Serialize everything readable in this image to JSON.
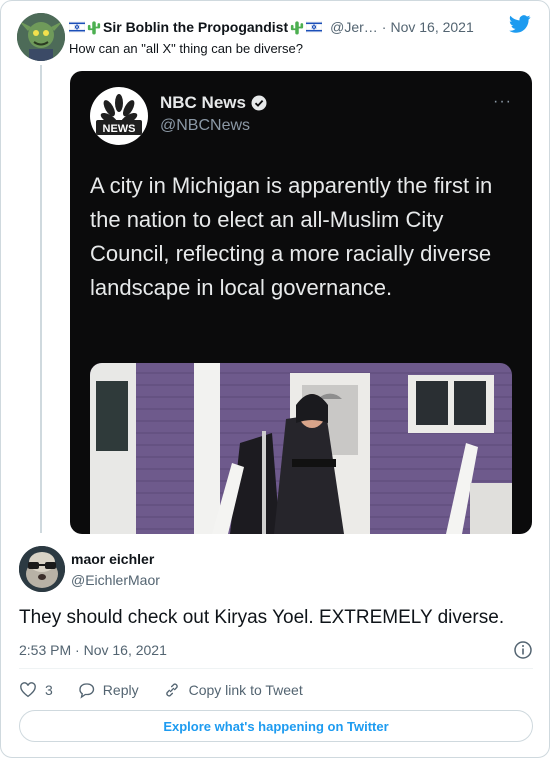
{
  "parent_tweet": {
    "name": "Sir Boblin the Propogandist",
    "handle": "@Jer…",
    "separator": "·",
    "date": "Nov 16, 2021",
    "text": "How can an \"all X\" thing can be diverse?"
  },
  "quoted_tweet": {
    "name": "NBC News",
    "handle": "@NBCNews",
    "logo_text": "NEWS",
    "more_label": "···",
    "text": "A city in Michigan is apparently the first in the nation to elect an all-Muslim City Council, reflecting a more racially diverse landscape in local governance."
  },
  "reply": {
    "name": "maor eichler",
    "handle": "@EichlerMaor",
    "text": "They should check out Kiryas Yoel. EXTREMELY diverse.",
    "timestamp": "2:53 PM · Nov 16, 2021"
  },
  "actions": {
    "like_count": "3",
    "reply_label": "Reply",
    "copy_link_label": "Copy link to Tweet"
  },
  "footer": {
    "explore_label": "Explore what's happening on Twitter"
  },
  "colors": {
    "accent": "#1d9bf0",
    "secondary_text": "#536471",
    "embed_bg": "#0b0b0c"
  },
  "icons": [
    "israel-flag-icon",
    "cactus-icon",
    "twitter-bird-icon",
    "verified-badge-icon",
    "more-options-icon",
    "info-icon",
    "heart-icon",
    "reply-icon",
    "link-icon"
  ]
}
